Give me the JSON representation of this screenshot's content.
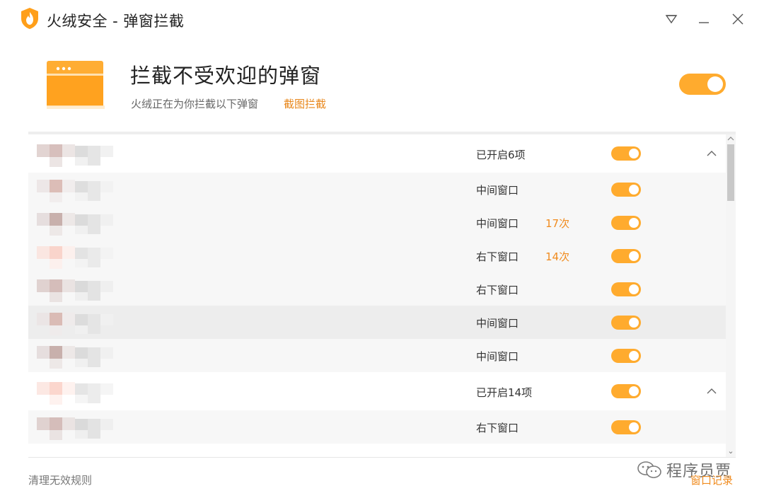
{
  "window": {
    "title": "火绒安全 - 弹窗拦截",
    "brand_color": "#ffab2e",
    "accent_text_color": "#f08b1e"
  },
  "header": {
    "title": "拦截不受欢迎的弹窗",
    "subtitle": "火绒正在为你拦截以下弹窗",
    "link": "截图拦截",
    "master_toggle_on": true
  },
  "groups": [
    {
      "status": "已开启6项",
      "toggle_on": true,
      "expanded": true,
      "items": [
        {
          "type": "中间窗口",
          "count": "",
          "toggle_on": true
        },
        {
          "type": "中间窗口",
          "count": "17次",
          "toggle_on": true
        },
        {
          "type": "右下窗口",
          "count": "14次",
          "toggle_on": true
        },
        {
          "type": "右下窗口",
          "count": "",
          "toggle_on": true
        },
        {
          "type": "中间窗口",
          "count": "",
          "toggle_on": true,
          "highlighted": true
        },
        {
          "type": "中间窗口",
          "count": "",
          "toggle_on": true
        }
      ]
    },
    {
      "status": "已开启14项",
      "toggle_on": true,
      "expanded": true,
      "items": [
        {
          "type": "右下窗口",
          "count": "",
          "toggle_on": true
        }
      ]
    }
  ],
  "footer": {
    "left_link": "清理无效规则",
    "right_link": "窗口记录"
  },
  "watermark": {
    "text": "程序员贾"
  },
  "icons": {
    "app_logo": "flame-shield-icon",
    "menu": "triangle-down-icon",
    "minimize": "minimize-icon",
    "close": "close-icon",
    "hero": "popup-window-icon",
    "collapse": "chevron-up-icon",
    "watermark": "wechat-icon"
  }
}
